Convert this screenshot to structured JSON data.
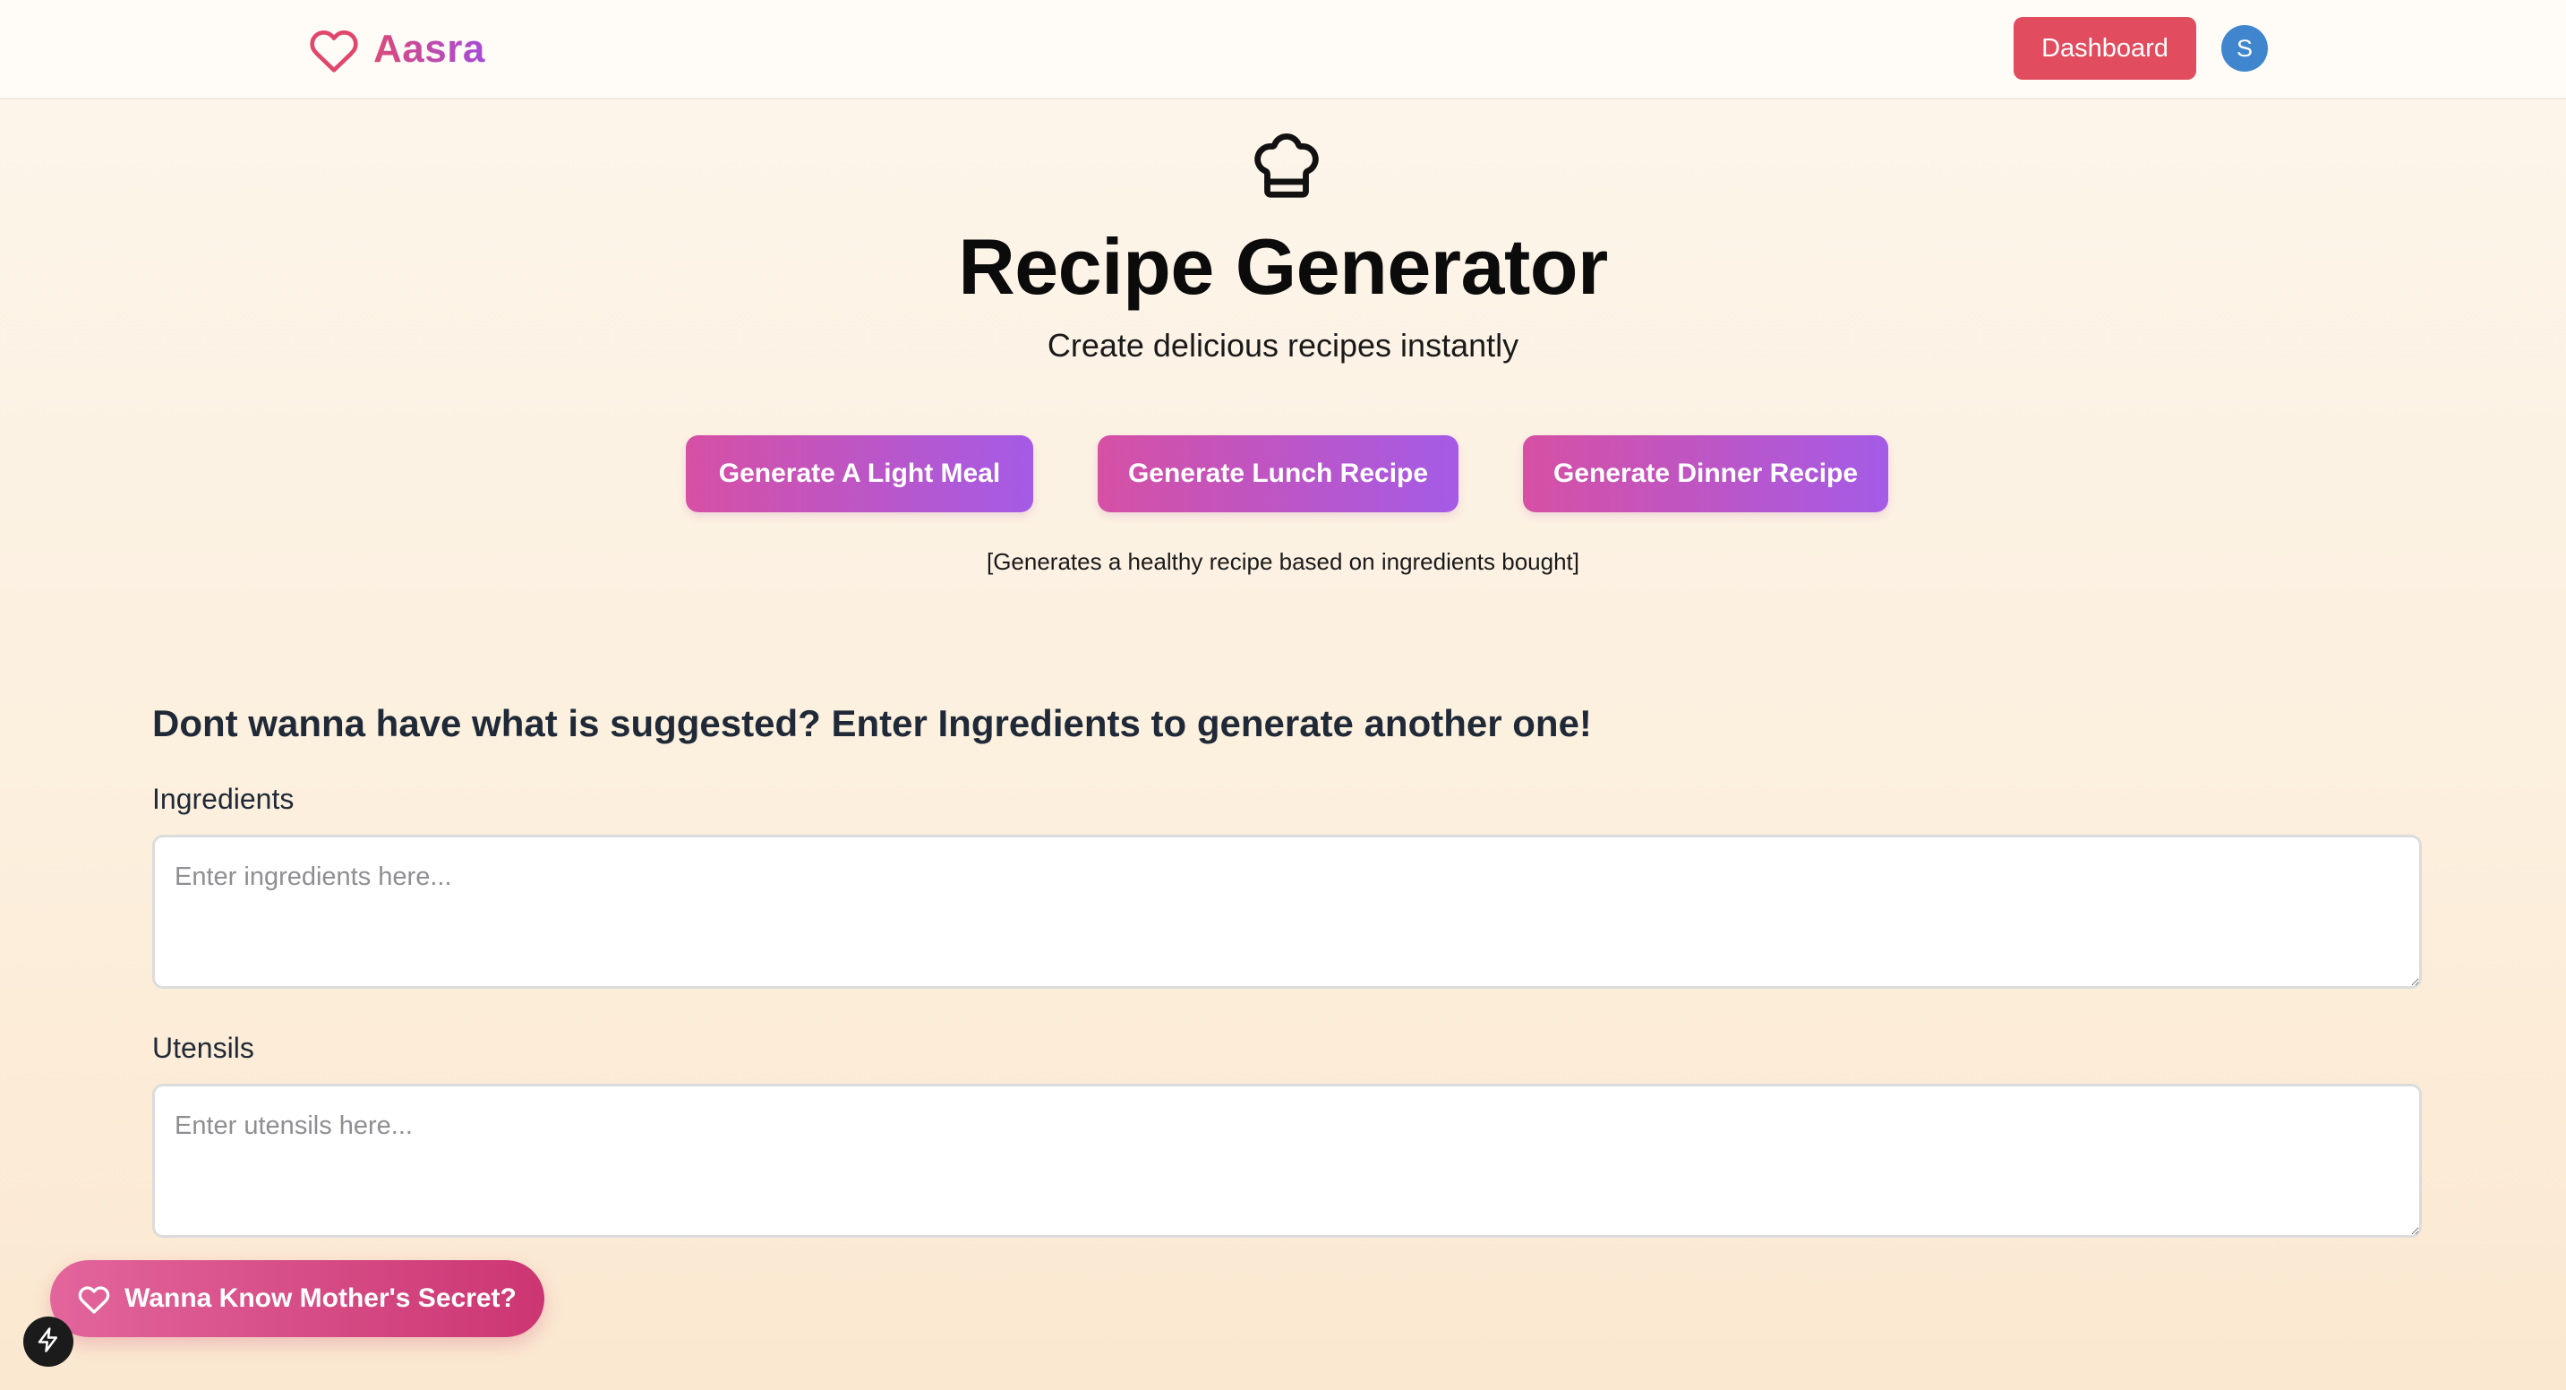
{
  "nav": {
    "brand_name": "Aasra",
    "brand_icon": "heart-outline-icon",
    "dashboard_label": "Dashboard",
    "avatar_initial": "S"
  },
  "hero": {
    "icon": "chef-hat-icon",
    "title": "Recipe Generator",
    "subtitle": "Create delicious recipes instantly",
    "buttons": {
      "light_meal": "Generate A Light Meal",
      "lunch": "Generate Lunch Recipe",
      "dinner": "Generate Dinner Recipe"
    },
    "note": "[Generates a healthy recipe based on ingredients bought]"
  },
  "form": {
    "heading": "Dont wanna have what is suggested? Enter Ingredients to generate another one!",
    "ingredients": {
      "label": "Ingredients",
      "placeholder": "Enter ingredients here...",
      "value": ""
    },
    "utensils": {
      "label": "Utensils",
      "placeholder": "Enter utensils here...",
      "value": ""
    }
  },
  "floating": {
    "secret_label": "Wanna Know Mother's Secret?",
    "secret_icon": "heart-outline-icon",
    "badge_icon": "lightning-bolt-icon"
  },
  "colors": {
    "brand_gradient": [
      "#db4b78",
      "#a74bd9"
    ],
    "dashboard": "#e14c5e",
    "avatar": "#3f86cf",
    "generate_gradient": [
      "#d650a4",
      "#a45be6"
    ],
    "secret_gradient": [
      "#e2659c",
      "#cc3672"
    ]
  }
}
